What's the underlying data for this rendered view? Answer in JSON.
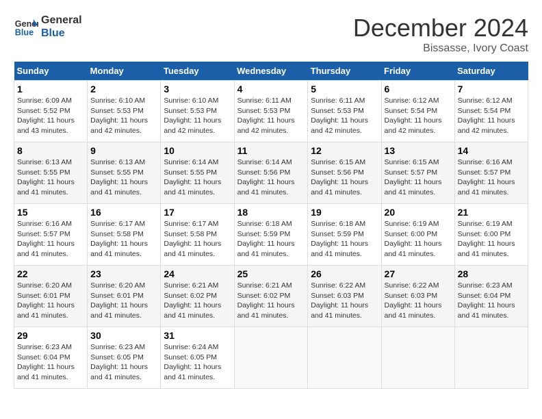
{
  "logo": {
    "line1": "General",
    "line2": "Blue"
  },
  "title": "December 2024",
  "location": "Bissasse, Ivory Coast",
  "days_of_week": [
    "Sunday",
    "Monday",
    "Tuesday",
    "Wednesday",
    "Thursday",
    "Friday",
    "Saturday"
  ],
  "weeks": [
    [
      {
        "day": "1",
        "sunrise": "6:09 AM",
        "sunset": "5:52 PM",
        "daylight": "11 hours and 43 minutes."
      },
      {
        "day": "2",
        "sunrise": "6:10 AM",
        "sunset": "5:53 PM",
        "daylight": "11 hours and 42 minutes."
      },
      {
        "day": "3",
        "sunrise": "6:10 AM",
        "sunset": "5:53 PM",
        "daylight": "11 hours and 42 minutes."
      },
      {
        "day": "4",
        "sunrise": "6:11 AM",
        "sunset": "5:53 PM",
        "daylight": "11 hours and 42 minutes."
      },
      {
        "day": "5",
        "sunrise": "6:11 AM",
        "sunset": "5:53 PM",
        "daylight": "11 hours and 42 minutes."
      },
      {
        "day": "6",
        "sunrise": "6:12 AM",
        "sunset": "5:54 PM",
        "daylight": "11 hours and 42 minutes."
      },
      {
        "day": "7",
        "sunrise": "6:12 AM",
        "sunset": "5:54 PM",
        "daylight": "11 hours and 42 minutes."
      }
    ],
    [
      {
        "day": "8",
        "sunrise": "6:13 AM",
        "sunset": "5:55 PM",
        "daylight": "11 hours and 41 minutes."
      },
      {
        "day": "9",
        "sunrise": "6:13 AM",
        "sunset": "5:55 PM",
        "daylight": "11 hours and 41 minutes."
      },
      {
        "day": "10",
        "sunrise": "6:14 AM",
        "sunset": "5:55 PM",
        "daylight": "11 hours and 41 minutes."
      },
      {
        "day": "11",
        "sunrise": "6:14 AM",
        "sunset": "5:56 PM",
        "daylight": "11 hours and 41 minutes."
      },
      {
        "day": "12",
        "sunrise": "6:15 AM",
        "sunset": "5:56 PM",
        "daylight": "11 hours and 41 minutes."
      },
      {
        "day": "13",
        "sunrise": "6:15 AM",
        "sunset": "5:57 PM",
        "daylight": "11 hours and 41 minutes."
      },
      {
        "day": "14",
        "sunrise": "6:16 AM",
        "sunset": "5:57 PM",
        "daylight": "11 hours and 41 minutes."
      }
    ],
    [
      {
        "day": "15",
        "sunrise": "6:16 AM",
        "sunset": "5:57 PM",
        "daylight": "11 hours and 41 minutes."
      },
      {
        "day": "16",
        "sunrise": "6:17 AM",
        "sunset": "5:58 PM",
        "daylight": "11 hours and 41 minutes."
      },
      {
        "day": "17",
        "sunrise": "6:17 AM",
        "sunset": "5:58 PM",
        "daylight": "11 hours and 41 minutes."
      },
      {
        "day": "18",
        "sunrise": "6:18 AM",
        "sunset": "5:59 PM",
        "daylight": "11 hours and 41 minutes."
      },
      {
        "day": "19",
        "sunrise": "6:18 AM",
        "sunset": "5:59 PM",
        "daylight": "11 hours and 41 minutes."
      },
      {
        "day": "20",
        "sunrise": "6:19 AM",
        "sunset": "6:00 PM",
        "daylight": "11 hours and 41 minutes."
      },
      {
        "day": "21",
        "sunrise": "6:19 AM",
        "sunset": "6:00 PM",
        "daylight": "11 hours and 41 minutes."
      }
    ],
    [
      {
        "day": "22",
        "sunrise": "6:20 AM",
        "sunset": "6:01 PM",
        "daylight": "11 hours and 41 minutes."
      },
      {
        "day": "23",
        "sunrise": "6:20 AM",
        "sunset": "6:01 PM",
        "daylight": "11 hours and 41 minutes."
      },
      {
        "day": "24",
        "sunrise": "6:21 AM",
        "sunset": "6:02 PM",
        "daylight": "11 hours and 41 minutes."
      },
      {
        "day": "25",
        "sunrise": "6:21 AM",
        "sunset": "6:02 PM",
        "daylight": "11 hours and 41 minutes."
      },
      {
        "day": "26",
        "sunrise": "6:22 AM",
        "sunset": "6:03 PM",
        "daylight": "11 hours and 41 minutes."
      },
      {
        "day": "27",
        "sunrise": "6:22 AM",
        "sunset": "6:03 PM",
        "daylight": "11 hours and 41 minutes."
      },
      {
        "day": "28",
        "sunrise": "6:23 AM",
        "sunset": "6:04 PM",
        "daylight": "11 hours and 41 minutes."
      }
    ],
    [
      {
        "day": "29",
        "sunrise": "6:23 AM",
        "sunset": "6:04 PM",
        "daylight": "11 hours and 41 minutes."
      },
      {
        "day": "30",
        "sunrise": "6:23 AM",
        "sunset": "6:05 PM",
        "daylight": "11 hours and 41 minutes."
      },
      {
        "day": "31",
        "sunrise": "6:24 AM",
        "sunset": "6:05 PM",
        "daylight": "11 hours and 41 minutes."
      },
      null,
      null,
      null,
      null
    ]
  ]
}
